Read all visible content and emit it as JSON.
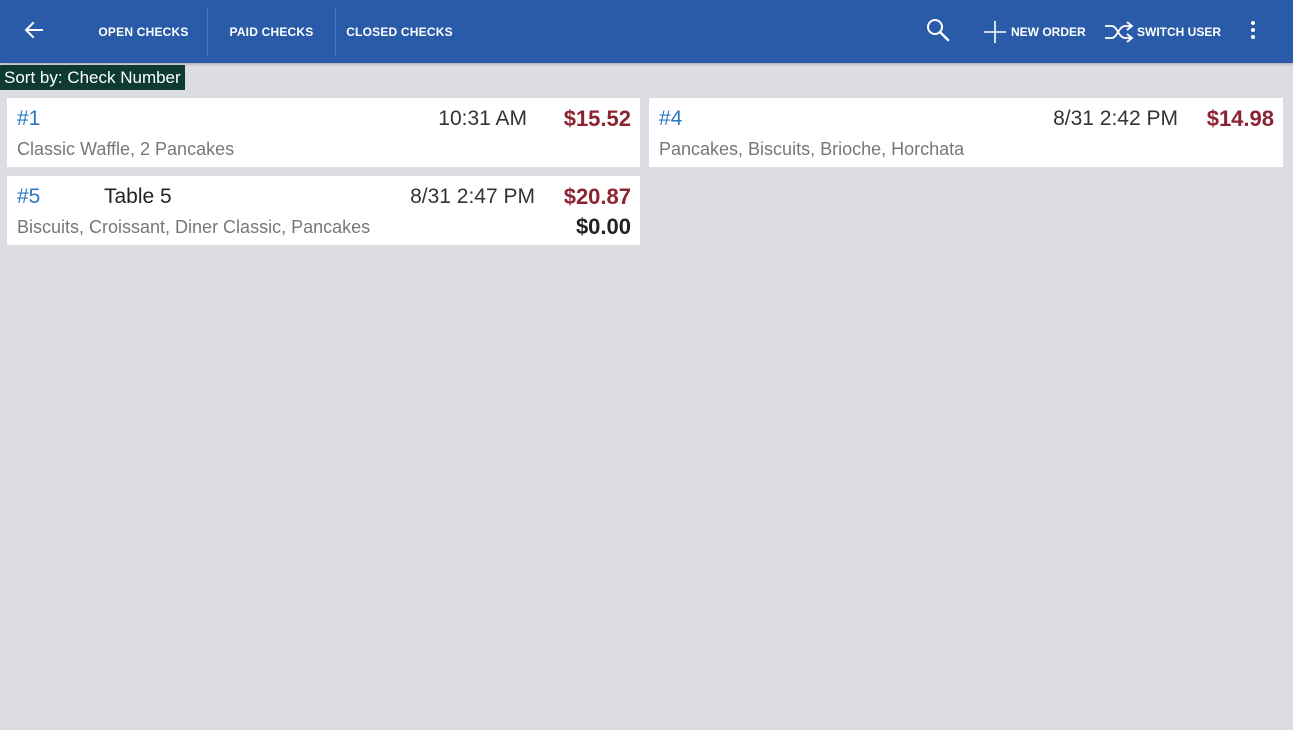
{
  "header": {
    "tabs": [
      {
        "label": "OPEN CHECKS"
      },
      {
        "label": "PAID CHECKS"
      },
      {
        "label": "CLOSED CHECKS"
      }
    ],
    "new_order_label": "NEW ORDER",
    "switch_user_label": "SWITCH USER",
    "icons": {
      "back": "arrow-left-icon",
      "search": "search-icon",
      "new_order": "plus-icon",
      "switch_user": "shuffle-icon",
      "more": "more-vertical-icon"
    },
    "colors": {
      "bar": "#2a5ba8",
      "text": "#ffffff"
    }
  },
  "sort": {
    "label": "Sort by: Check Number"
  },
  "checks": [
    {
      "number": "#1",
      "table": "",
      "time": "10:31 AM",
      "total": "$15.52",
      "items": "Classic Waffle, 2 Pancakes",
      "due": ""
    },
    {
      "number": "#4",
      "table": "",
      "time": "8/31 2:42 PM",
      "total": "$14.98",
      "items": "Pancakes, Biscuits, Brioche, Horchata",
      "due": ""
    },
    {
      "number": "#5",
      "table": "Table 5",
      "time": "8/31 2:47 PM",
      "total": "$20.87",
      "items": "Biscuits, Croissant, Diner Classic, Pancakes",
      "due": "$0.00"
    }
  ],
  "colors": {
    "background": "#dcdde2",
    "check_number": "#2b79c2",
    "total": "#8b2332",
    "sort_badge": "#0d3b33"
  }
}
